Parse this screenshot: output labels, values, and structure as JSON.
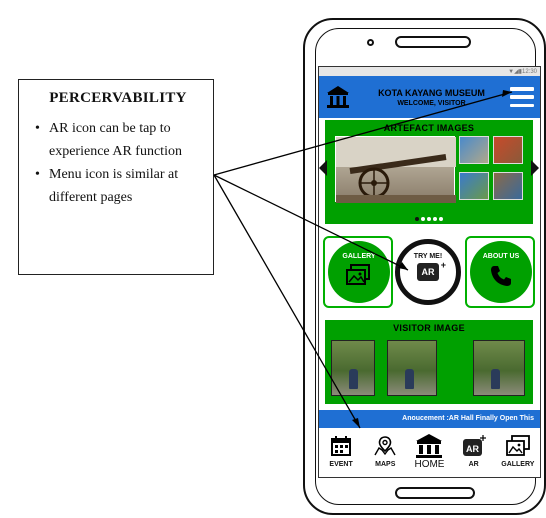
{
  "annotation": {
    "title": "PERCERVABILITY",
    "bullets": [
      "AR icon can be tap to experience AR function",
      "Menu icon is similar at different pages"
    ]
  },
  "app": {
    "status": "▼◢▮12:30",
    "title": "KOTA KAYANG MUSEUM",
    "subtitle": "WELCOME, VISITOR",
    "artefact_title": "ARTEFACT IMAGES",
    "visitor_title": "VISITOR IMAGE",
    "gallery_label": "GALLERY",
    "try_label": "TRY ME!",
    "ar_label": "AR",
    "about_label": "ABOUT US",
    "announcement": "Anoucement :AR Hall Finally Open This",
    "carousel_active_index": 0,
    "carousel_count": 5
  },
  "nav": [
    {
      "label": "EVENT",
      "icon": "calendar-icon"
    },
    {
      "label": "MAPS",
      "icon": "map-icon"
    },
    {
      "label": "HOME",
      "icon": "museum-icon"
    },
    {
      "label": "AR",
      "icon": "ar-icon"
    },
    {
      "label": "GALLERY",
      "icon": "gallery-icon"
    }
  ],
  "colors": {
    "appbar": "#1f6fd3",
    "green": "#00a000"
  }
}
